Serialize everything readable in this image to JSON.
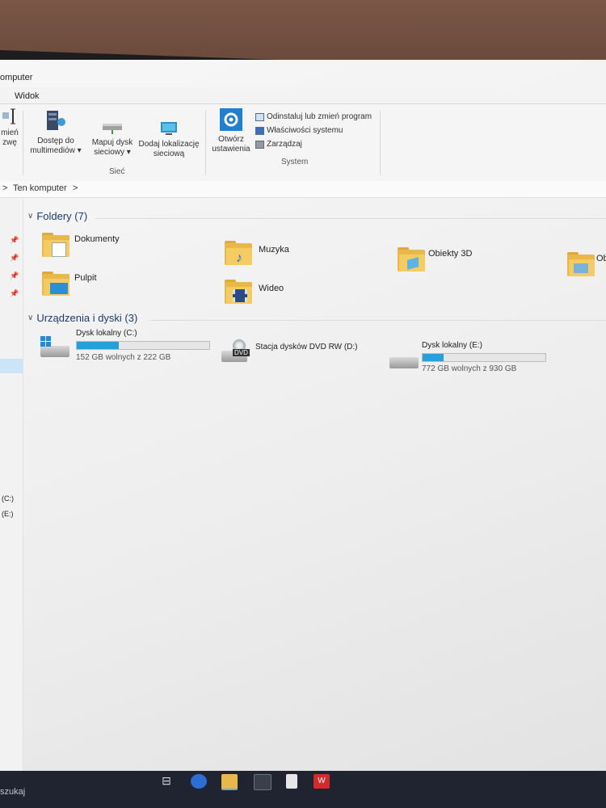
{
  "window": {
    "title_fragment": "omputer"
  },
  "menu": {
    "tab_view": "Widok"
  },
  "ribbon": {
    "left_cut_label_1": "mień",
    "left_cut_label_2": "zwę",
    "media_access": {
      "line1": "Dostęp do",
      "line2": "multimediów ▾"
    },
    "map_drive": {
      "line1": "Mapuj dysk",
      "line2": "sieciowy ▾"
    },
    "add_location": {
      "line1": "Dodaj lokalizację",
      "line2": "sieciową"
    },
    "group_network": "Sieć",
    "open_settings": {
      "line1": "Otwórz",
      "line2": "ustawienia"
    },
    "system_items": [
      "Odinstaluj lub zmień program",
      "Właściwości systemu",
      "Zarządzaj"
    ],
    "group_system": "System"
  },
  "address": {
    "sep": ">",
    "location": "Ten komputer",
    "chevron": ">"
  },
  "nav": {
    "drive_c": "(C:)",
    "drive_e": "(E:)"
  },
  "folders_section": {
    "header": "Foldery (7)",
    "items": [
      "Dokumenty",
      "Muzyka",
      "Obiekty 3D",
      "Ob",
      "Pulpit",
      "Wideo"
    ]
  },
  "devices_section": {
    "header": "Urządzenia i dyski (3)",
    "drives": [
      {
        "name": "Dysk lokalny (C:)",
        "free": "152 GB wolnych z 222 GB",
        "used_fraction": 0.32
      },
      {
        "name": "Stacja dysków DVD RW (D:)",
        "badge": "DVD"
      },
      {
        "name": "Dysk lokalny (E:)",
        "free": "772 GB wolnych z 930 GB",
        "used_fraction": 0.17
      }
    ]
  },
  "taskbar": {
    "search_fragment": "szukaj"
  },
  "colors": {
    "accent": "#26a0da",
    "folder": "#f5cc62",
    "header_text": "#1e3a6e"
  }
}
